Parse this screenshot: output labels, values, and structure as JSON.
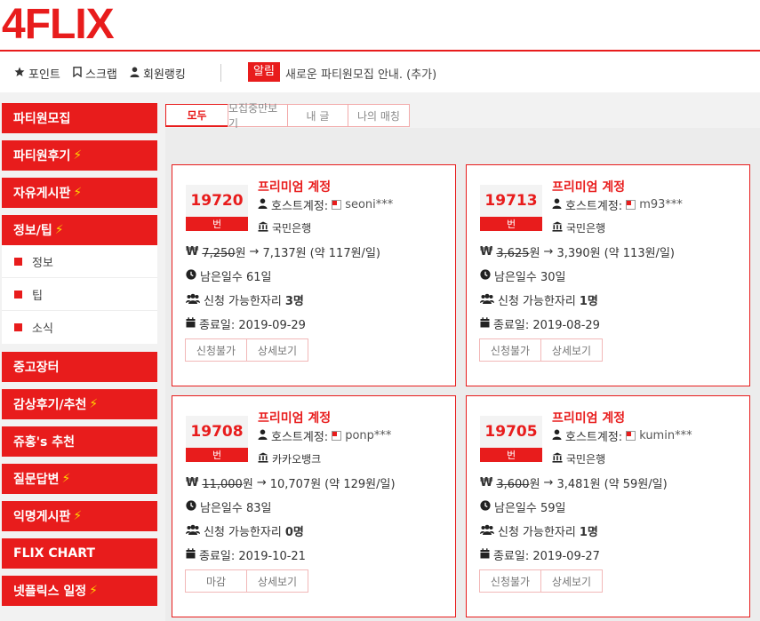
{
  "app": {
    "logo": "4FLIX"
  },
  "topbar": {
    "point_label": "포인트",
    "scrap_label": "스크랩",
    "ranking_label": "회원랭킹",
    "notice_badge": "알림",
    "notice_text": "새로운 파티원모집 안내. (추가)"
  },
  "sidebar": {
    "items": [
      {
        "label": "파티원모집",
        "bolt": false
      },
      {
        "label": "파티원후기",
        "bolt": true
      },
      {
        "label": "자유게시판",
        "bolt": true
      },
      {
        "label": "정보/팁",
        "bolt": true
      },
      {
        "label": "중고장터",
        "bolt": false
      },
      {
        "label": "감상후기/추천",
        "bolt": true
      },
      {
        "label": "쥬홍's 추천",
        "bolt": false
      },
      {
        "label": "질문답변",
        "bolt": true
      },
      {
        "label": "익명게시판",
        "bolt": true
      },
      {
        "label": "FLIX CHART",
        "bolt": false
      },
      {
        "label": "넷플릭스 일정",
        "bolt": true
      }
    ],
    "sub_items": [
      "정보",
      "팁",
      "소식"
    ]
  },
  "tabs": [
    "모두",
    "모집중만보기",
    "내 글",
    "나의 매칭"
  ],
  "cards": [
    {
      "number": "19720",
      "number_suffix": "번",
      "title": "프리미엄 계정",
      "host_label": "호스트계정:",
      "host": "seoni***",
      "bank": "국민은행",
      "won_symbol": "₩",
      "price_orig": "7,250",
      "price_unit": "원",
      "arrow": "→",
      "price_new": "7,137원",
      "per_day": "(약 117원/일)",
      "days_left": "남은일수 61일",
      "slots_label": "신청 가능한자리",
      "slots": "3명",
      "end_date": "종료일: 2019-09-29",
      "btn1": "신청불가",
      "btn2": "상세보기"
    },
    {
      "number": "19713",
      "number_suffix": "번",
      "title": "프리미엄 계정",
      "host_label": "호스트계정:",
      "host": "m93***",
      "bank": "국민은행",
      "won_symbol": "₩",
      "price_orig": "3,625",
      "price_unit": "원",
      "arrow": "→",
      "price_new": "3,390원",
      "per_day": "(약 113원/일)",
      "days_left": "남은일수 30일",
      "slots_label": "신청 가능한자리",
      "slots": "1명",
      "end_date": "종료일: 2019-08-29",
      "btn1": "신청불가",
      "btn2": "상세보기"
    },
    {
      "number": "19708",
      "number_suffix": "번",
      "title": "프리미엄 계정",
      "host_label": "호스트계정:",
      "host": "ponp***",
      "bank": "카카오뱅크",
      "won_symbol": "₩",
      "price_orig": "11,000",
      "price_unit": "원",
      "arrow": "→",
      "price_new": "10,707원",
      "per_day": "(약 129원/일)",
      "days_left": "남은일수 83일",
      "slots_label": "신청 가능한자리",
      "slots": "0명",
      "end_date": "종료일: 2019-10-21",
      "btn1": "마감",
      "btn2": "상세보기"
    },
    {
      "number": "19705",
      "number_suffix": "번",
      "title": "프리미엄 계정",
      "host_label": "호스트계정:",
      "host": "kumin***",
      "bank": "국민은행",
      "won_symbol": "₩",
      "price_orig": "3,600",
      "price_unit": "원",
      "arrow": "→",
      "price_new": "3,481원",
      "per_day": "(약 59원/일)",
      "days_left": "남은일수 59일",
      "slots_label": "신청 가능한자리",
      "slots": "1명",
      "end_date": "종료일: 2019-09-27",
      "btn1": "신청불가",
      "btn2": "상세보기"
    }
  ],
  "colors": {
    "accent": "#e81c1c",
    "bolt": "#ffd400"
  }
}
